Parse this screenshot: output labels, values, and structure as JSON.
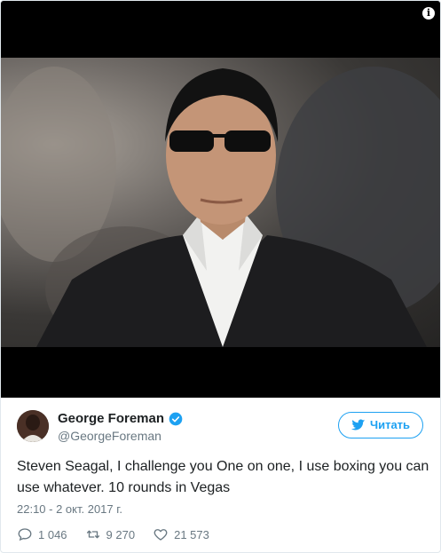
{
  "media": {
    "info_icon": "info-icon"
  },
  "author": {
    "display_name": "George Foreman",
    "handle": "@GeorgeForeman",
    "verified_icon": "verified-badge-icon",
    "avatar_icon": "avatar"
  },
  "follow": {
    "label": "Читать",
    "icon": "twitter-bird-icon"
  },
  "tweet": {
    "text": "Steven Seagal, I challenge you One on one, I use boxing you can use whatever. 10 rounds in Vegas",
    "timestamp": "22:10 - 2 окт. 2017 г."
  },
  "actions": {
    "replies": "1 046",
    "retweets": "9 270",
    "likes": "21 573",
    "icons": [
      "reply-icon",
      "retweet-icon",
      "heart-icon"
    ]
  },
  "colors": {
    "accent": "#1da1f2",
    "secondary_text": "#697882",
    "primary_text": "#1c2022",
    "media_background": "#000000"
  }
}
